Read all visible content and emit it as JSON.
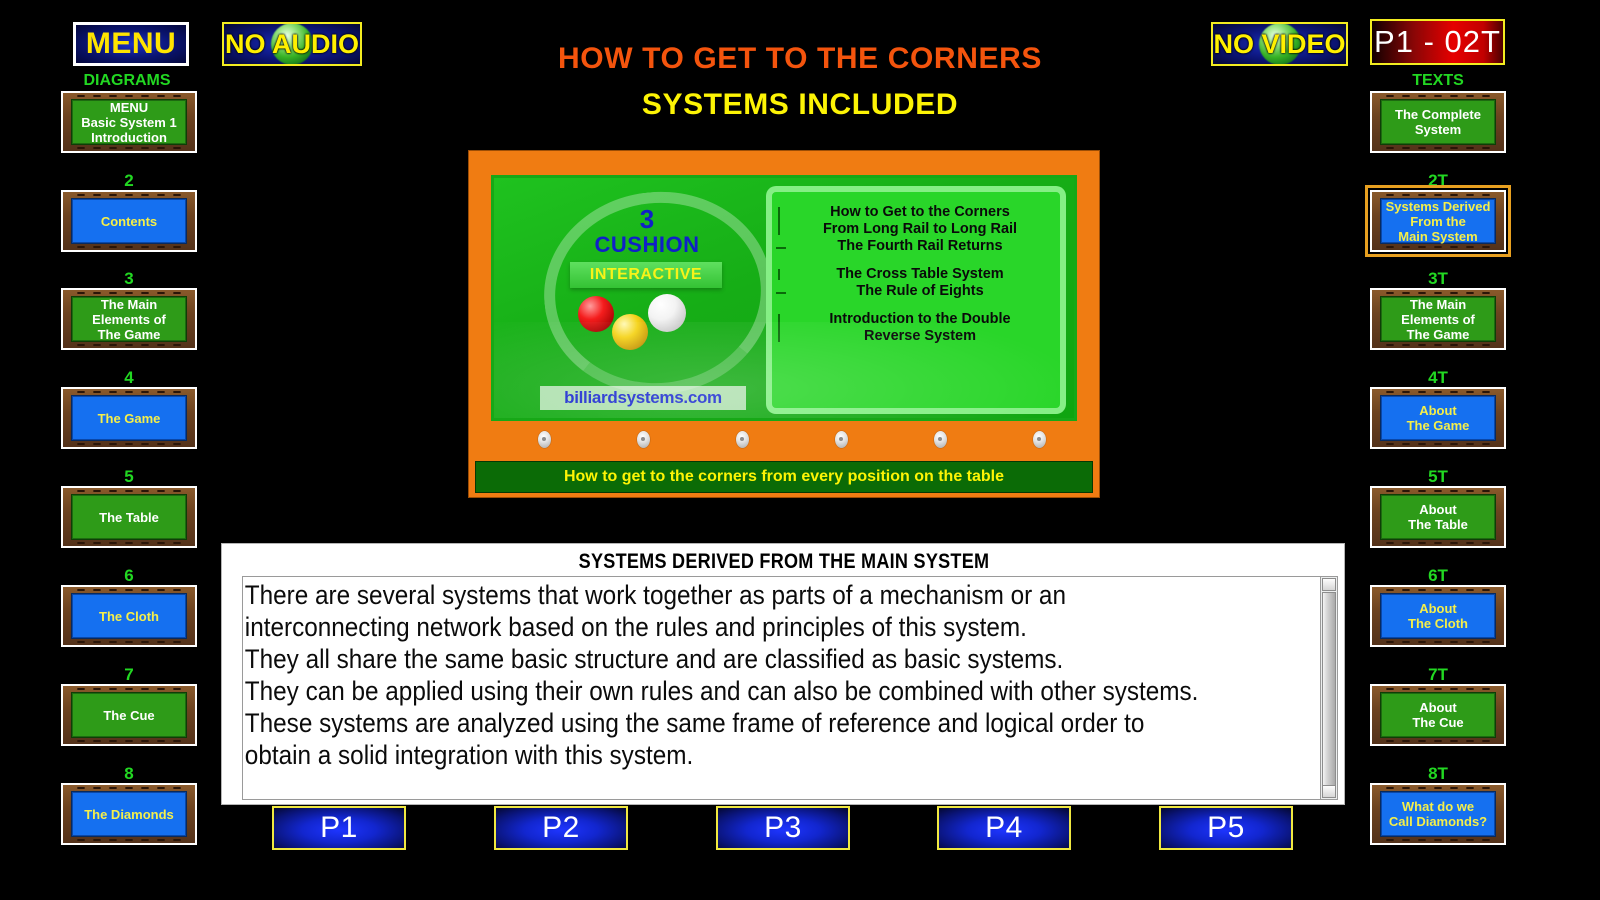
{
  "topbar": {
    "menu_label": "MENU",
    "no_audio_label": "NO AUDIO",
    "no_video_label": "NO VIDEO",
    "page_badge": "P1 - 02T"
  },
  "title": {
    "line1": "HOW TO GET TO THE CORNERS",
    "line2": "SYSTEMS INCLUDED"
  },
  "left_sidebar": {
    "heading": "DIAGRAMS",
    "items": [
      {
        "num": "",
        "label": "MENU\nBasic System 1\nIntroduction",
        "cloth": "green",
        "selected": false
      },
      {
        "num": "2",
        "label": "Contents",
        "cloth": "blue",
        "selected": false
      },
      {
        "num": "3",
        "label": "The Main\nElements of\nThe Game",
        "cloth": "green",
        "selected": false
      },
      {
        "num": "4",
        "label": "The Game",
        "cloth": "blue",
        "selected": false
      },
      {
        "num": "5",
        "label": "The Table",
        "cloth": "green",
        "selected": false
      },
      {
        "num": "6",
        "label": "The Cloth",
        "cloth": "blue",
        "selected": false
      },
      {
        "num": "7",
        "label": "The Cue",
        "cloth": "green",
        "selected": false
      },
      {
        "num": "8",
        "label": "The Diamonds",
        "cloth": "blue",
        "selected": false
      }
    ]
  },
  "right_sidebar": {
    "heading": "TEXTS",
    "items": [
      {
        "num": "",
        "label": "The Complete\nSystem",
        "cloth": "green",
        "selected": false
      },
      {
        "num": "2T",
        "label": "Systems Derived\nFrom the\nMain System",
        "cloth": "blue",
        "selected": true
      },
      {
        "num": "3T",
        "label": "The Main\nElements of\nThe Game",
        "cloth": "green",
        "selected": false
      },
      {
        "num": "4T",
        "label": "About\nThe Game",
        "cloth": "blue",
        "selected": false
      },
      {
        "num": "5T",
        "label": "About\nThe Table",
        "cloth": "green",
        "selected": false
      },
      {
        "num": "6T",
        "label": "About\nThe Cloth",
        "cloth": "blue",
        "selected": false
      },
      {
        "num": "7T",
        "label": "About\nThe Cue",
        "cloth": "green",
        "selected": false
      },
      {
        "num": "8T",
        "label": "What do we\nCall Diamonds?",
        "cloth": "blue",
        "selected": false
      }
    ]
  },
  "promo": {
    "logo_number": "3",
    "logo_cushion": "CUSHION",
    "logo_interactive": "INTERACTIVE",
    "logo_site": "billiardsystems.com",
    "bullets": [
      {
        "text": "How to Get to the Corners\nFrom Long Rail to Long Rail",
        "dash": false
      },
      {
        "text": "The Fourth Rail Returns",
        "dash": true
      },
      {
        "text": "The Cross Table System",
        "dash": false
      },
      {
        "text": "The Rule of Eights",
        "dash": true
      },
      {
        "text": "Introduction to the Double\nReverse System",
        "dash": false
      }
    ],
    "caption": "How to get to the corners from every position on the table"
  },
  "text_panel": {
    "title": "SYSTEMS DERIVED FROM THE MAIN SYSTEM",
    "body": "There are several systems that work together as parts of a mechanism or an interconnecting network based on the rules and principles of this system.\nThey all share the same basic structure and are classified as basic systems.\nThey can be applied using their own rules and can also be combined with other systems. These systems are analyzed using the same frame of reference and logical order to obtain a solid integration with this system."
  },
  "pager": {
    "buttons": [
      "P1",
      "P2",
      "P3",
      "P4",
      "P5"
    ]
  },
  "colors": {
    "title_orange": "#f4540d",
    "title_yellow": "#fdf405",
    "green_label": "#22d822",
    "badge_red": "#e60000",
    "cloth_green": "#2e9b18",
    "cloth_blue": "#1570f0"
  }
}
